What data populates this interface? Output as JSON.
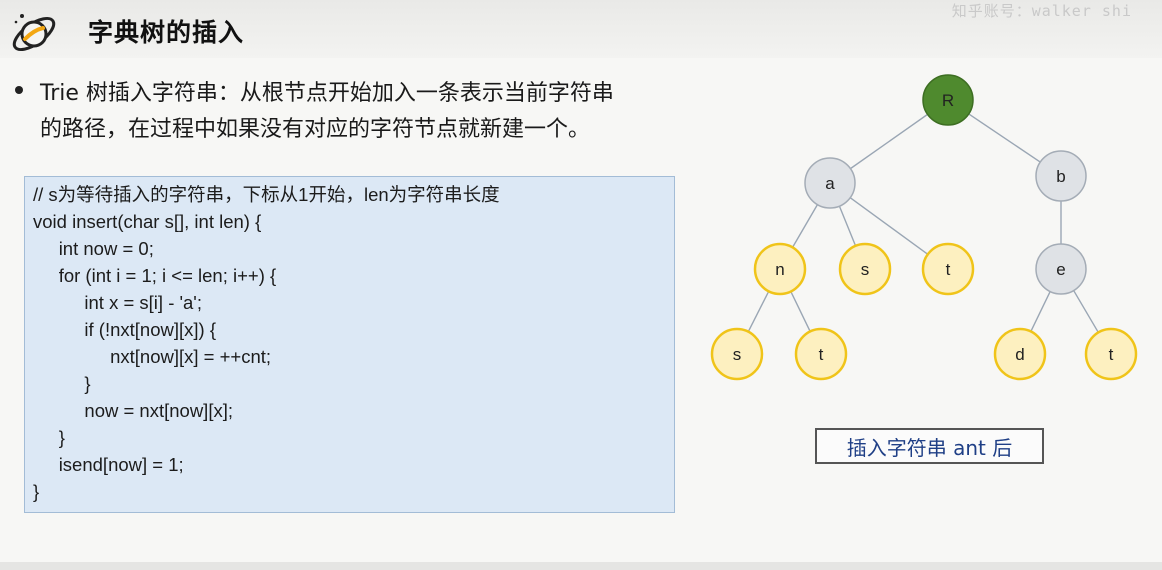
{
  "header": {
    "title": "字典树的插入",
    "watermark": "知乎账号：walker shi"
  },
  "bullet": {
    "text": "Trie 树插入字符串：从根节点开始加入一条表示当前字符串\n的路径，在过程中如果没有对应的字符节点就新建一个。"
  },
  "code": {
    "lines": [
      "// s为等待插入的字符串，下标从1开始，len为字符串长度",
      "void insert(char s[], int len) {",
      "     int now = 0;",
      "     for (int i = 1; i <= len; i++) {",
      "          int x = s[i] - 'a';",
      "          if (!nxt[now][x]) {",
      "               nxt[now][x] = ++cnt;",
      "          }",
      "          now = nxt[now][x];",
      "     }",
      "     isend[now] = 1;",
      "}"
    ]
  },
  "tree": {
    "colors": {
      "root_fill": "#4f8a2e",
      "inner_fill": "#dfe2e6",
      "leaf_fill": "#fdf0c0",
      "leaf_stroke": "#f0c419",
      "edge": "#9aa6b4"
    },
    "nodes": [
      {
        "id": "R",
        "label": "R",
        "kind": "root"
      },
      {
        "id": "a",
        "label": "a",
        "kind": "inner"
      },
      {
        "id": "b",
        "label": "b",
        "kind": "inner"
      },
      {
        "id": "an",
        "label": "n",
        "kind": "leaf"
      },
      {
        "id": "as",
        "label": "s",
        "kind": "leaf"
      },
      {
        "id": "at",
        "label": "t",
        "kind": "leaf"
      },
      {
        "id": "be",
        "label": "e",
        "kind": "inner"
      },
      {
        "id": "ans",
        "label": "s",
        "kind": "leaf"
      },
      {
        "id": "ant",
        "label": "t",
        "kind": "leaf"
      },
      {
        "id": "bed",
        "label": "d",
        "kind": "leaf"
      },
      {
        "id": "bet",
        "label": "t",
        "kind": "leaf"
      }
    ],
    "edges": [
      [
        "R",
        "a"
      ],
      [
        "R",
        "b"
      ],
      [
        "a",
        "an"
      ],
      [
        "a",
        "as"
      ],
      [
        "a",
        "at"
      ],
      [
        "b",
        "be"
      ],
      [
        "an",
        "ans"
      ],
      [
        "an",
        "ant"
      ],
      [
        "be",
        "bed"
      ],
      [
        "be",
        "bet"
      ]
    ]
  },
  "caption": {
    "text": "插入字符串 ant 后"
  }
}
